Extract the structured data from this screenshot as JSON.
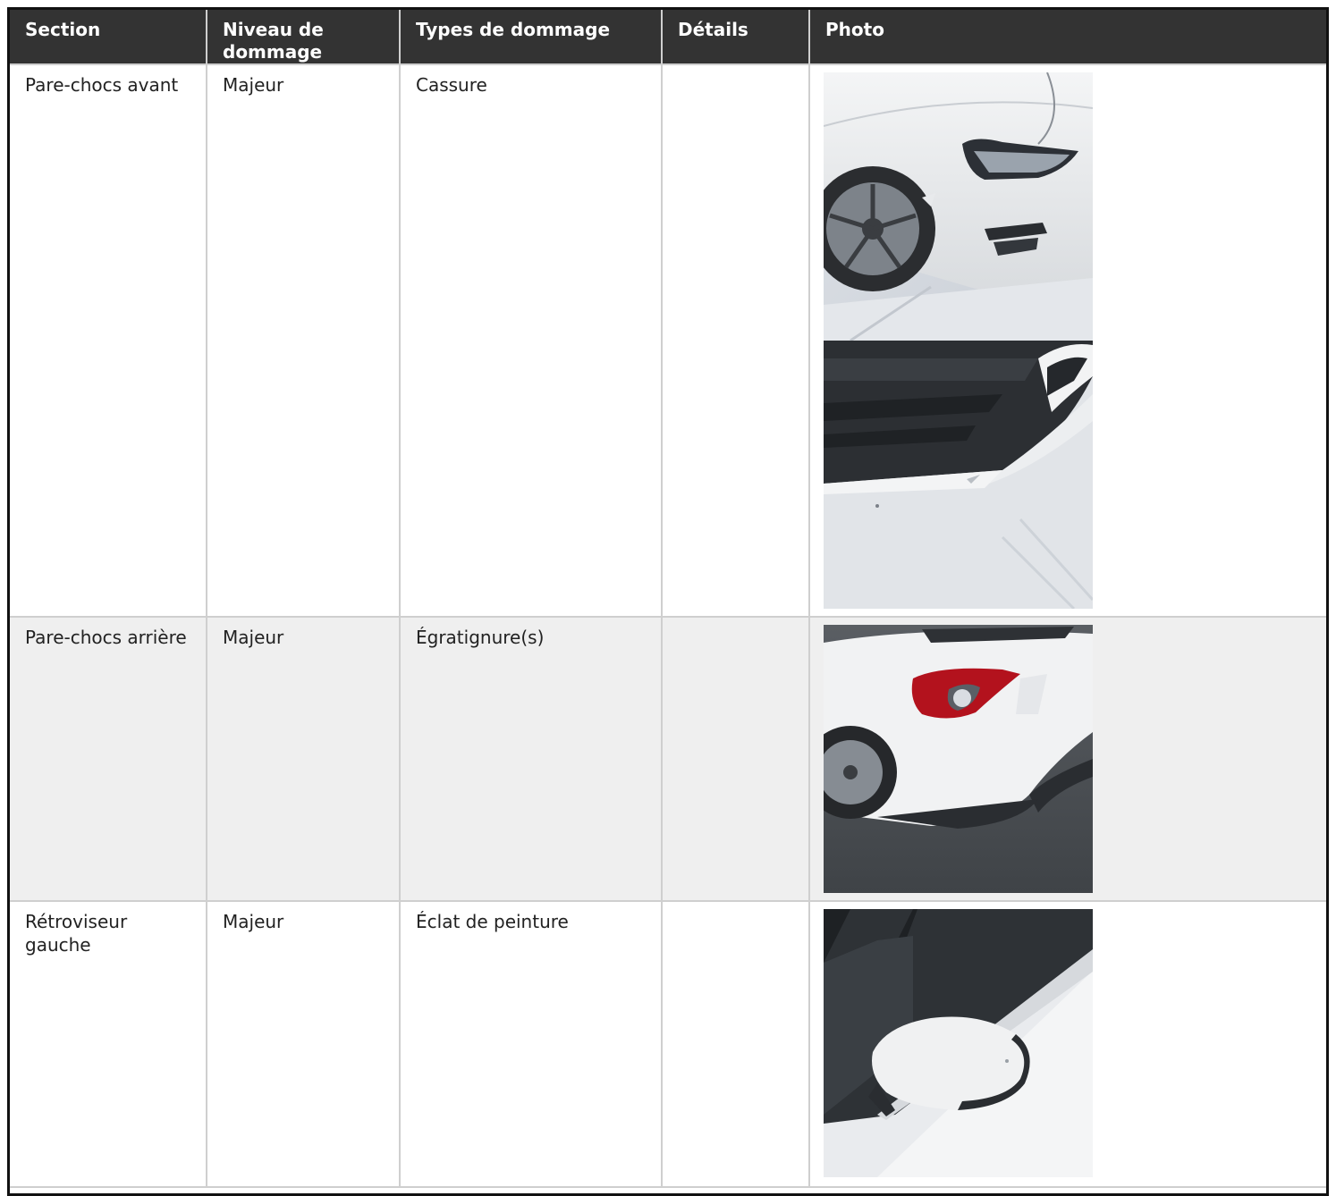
{
  "table": {
    "headers": [
      "Section",
      "Niveau de dommage",
      "Types de dommage",
      "Détails",
      "Photo"
    ],
    "rows": [
      {
        "section": "Pare-chocs avant",
        "level": "Majeur",
        "type": "Cassure",
        "details": "",
        "photos": [
          "front-corner-damage-photo",
          "front-bumper-lip-photo"
        ]
      },
      {
        "section": "Pare-chocs arrière",
        "level": "Majeur",
        "type": "Égratignure(s)",
        "details": "",
        "photos": [
          "rear-bumper-taillight-photo"
        ]
      },
      {
        "section": "Rétroviseur gauche",
        "level": "Majeur",
        "type": "Éclat de peinture",
        "details": "",
        "photos": [
          "left-mirror-photo"
        ]
      }
    ]
  }
}
